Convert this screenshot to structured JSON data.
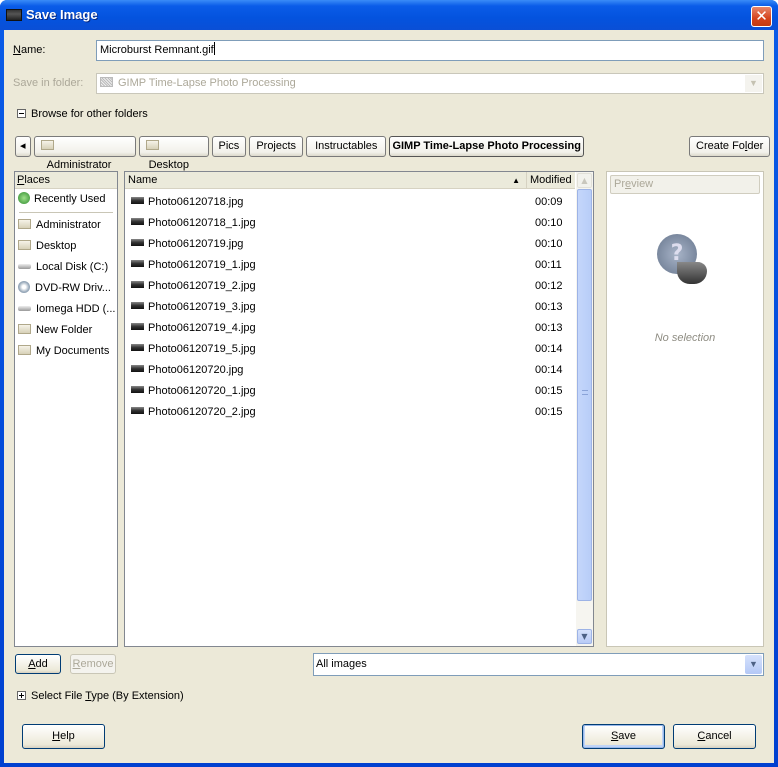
{
  "window": {
    "title": "Save Image",
    "close_symbol": "✕"
  },
  "form": {
    "name_label": "Name:",
    "name_value": "Microburst Remnant.gif",
    "save_in_label": "Save in folder:",
    "save_in_value": "GIMP Time-Lapse Photo Processing",
    "browse_label": "Browse for other folders"
  },
  "path_bar": {
    "back_symbol": "◂",
    "crumbs": [
      {
        "label": "Administrator",
        "has_icon": true
      },
      {
        "label": "Desktop",
        "has_icon": true
      },
      {
        "label": "Pics",
        "has_icon": false
      },
      {
        "label": "Projects",
        "has_icon": false
      },
      {
        "label": "Instructables",
        "has_icon": false
      },
      {
        "label": "GIMP Time-Lapse Photo Processing",
        "has_icon": false,
        "active": true
      }
    ],
    "create_folder_label": "Create Folder"
  },
  "places": {
    "header": "Places",
    "items": [
      {
        "label": "Recently Used",
        "icon": "recent-icon"
      },
      {
        "label": "Administrator",
        "icon": "folder-icon"
      },
      {
        "label": "Desktop",
        "icon": "folder-icon"
      },
      {
        "label": "Local Disk (C:)",
        "icon": "drive-icon"
      },
      {
        "label": "DVD-RW Driv...",
        "icon": "dvd-icon"
      },
      {
        "label": "Iomega HDD (...",
        "icon": "drive-icon"
      },
      {
        "label": "New Folder",
        "icon": "folder-icon"
      },
      {
        "label": "My Documents",
        "icon": "folder-icon"
      }
    ],
    "add_label": "Add",
    "remove_label": "Remove"
  },
  "files": {
    "col_name": "Name",
    "col_modified": "Modified",
    "sort_symbol": "▲",
    "rows": [
      {
        "name": "Photo06120718.jpg",
        "modified": "00:09"
      },
      {
        "name": "Photo06120718_1.jpg",
        "modified": "00:10"
      },
      {
        "name": "Photo06120719.jpg",
        "modified": "00:10"
      },
      {
        "name": "Photo06120719_1.jpg",
        "modified": "00:11"
      },
      {
        "name": "Photo06120719_2.jpg",
        "modified": "00:12"
      },
      {
        "name": "Photo06120719_3.jpg",
        "modified": "00:13"
      },
      {
        "name": "Photo06120719_4.jpg",
        "modified": "00:13"
      },
      {
        "name": "Photo06120719_5.jpg",
        "modified": "00:14"
      },
      {
        "name": "Photo06120720.jpg",
        "modified": "00:14"
      },
      {
        "name": "Photo06120720_1.jpg",
        "modified": "00:15"
      },
      {
        "name": "Photo06120720_2.jpg",
        "modified": "00:15"
      }
    ],
    "filter_value": "All images"
  },
  "preview": {
    "header": "Preview",
    "no_selection": "No selection"
  },
  "footer": {
    "file_type_label": "Select File Type (By Extension)",
    "help_label": "Help",
    "save_label": "Save",
    "cancel_label": "Cancel"
  }
}
